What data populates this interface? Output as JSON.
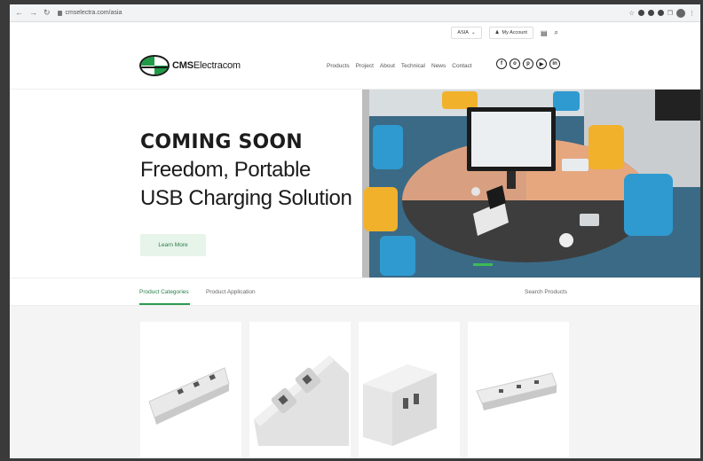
{
  "browser": {
    "url": "cmselectra.com/asia"
  },
  "util": {
    "region": "ASIA",
    "account": "My Account"
  },
  "brand": {
    "logo_bold": "CMS",
    "logo_rest": "Electracom"
  },
  "nav": {
    "items": [
      "Products",
      "Project",
      "About",
      "Technical",
      "News",
      "Contact"
    ]
  },
  "social": {
    "icons": [
      "facebook-icon",
      "instagram-icon",
      "pinterest-icon",
      "youtube-icon",
      "linkedin-icon"
    ],
    "glyphs": [
      "f",
      "o",
      "p",
      "▶",
      "in"
    ]
  },
  "hero": {
    "heading": "COMING SOON",
    "line1": "Freedom, Portable",
    "line2": "USB Charging Solution",
    "button": "Learn More"
  },
  "tabs": {
    "categories": "Product Categories",
    "application": "Product Application",
    "search": "Search Products"
  },
  "colors": {
    "brand_green": "#1f9a45",
    "accent_green": "#2a9a4f",
    "button_bg": "#e6f4ea"
  }
}
